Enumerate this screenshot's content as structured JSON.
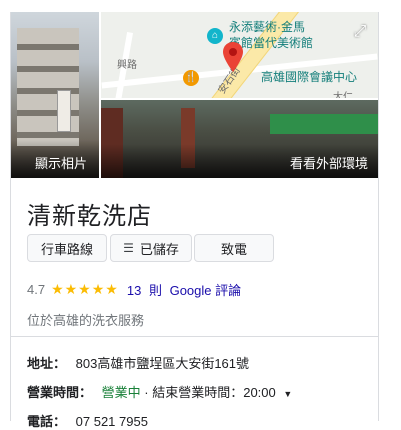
{
  "photos": {
    "left_caption": "顯示相片",
    "right_caption": "看看外部環境"
  },
  "map": {
    "poi1": "永添藝術·金馬",
    "poi1_sub": "賓館當代美術館",
    "poi2": "高雄國際會議中心",
    "road1": "興路",
    "road2": "安石街",
    "road3": "大仁",
    "road4": "大仁路"
  },
  "business": {
    "name": "清新乾洗店",
    "category": "位於高雄的洗衣服務"
  },
  "actions": {
    "route": "行車路線",
    "saved": "已儲存",
    "call": "致電"
  },
  "rating": {
    "score": "4.7",
    "stars": "★★★★★",
    "count": "13",
    "unit": "則",
    "source": "Google 評論"
  },
  "info": {
    "address_label": "地址：",
    "address": "803高雄市鹽埕區大安街161號",
    "hours_label": "營業時間：",
    "hours_status": "營業中",
    "hours_detail": "· 結束營業時間：20:00",
    "phone_label": "電話：",
    "phone": "07 521 7955"
  },
  "colors": {
    "open": "#188038",
    "link": "#1a0dab",
    "star": "#fbbc04"
  }
}
